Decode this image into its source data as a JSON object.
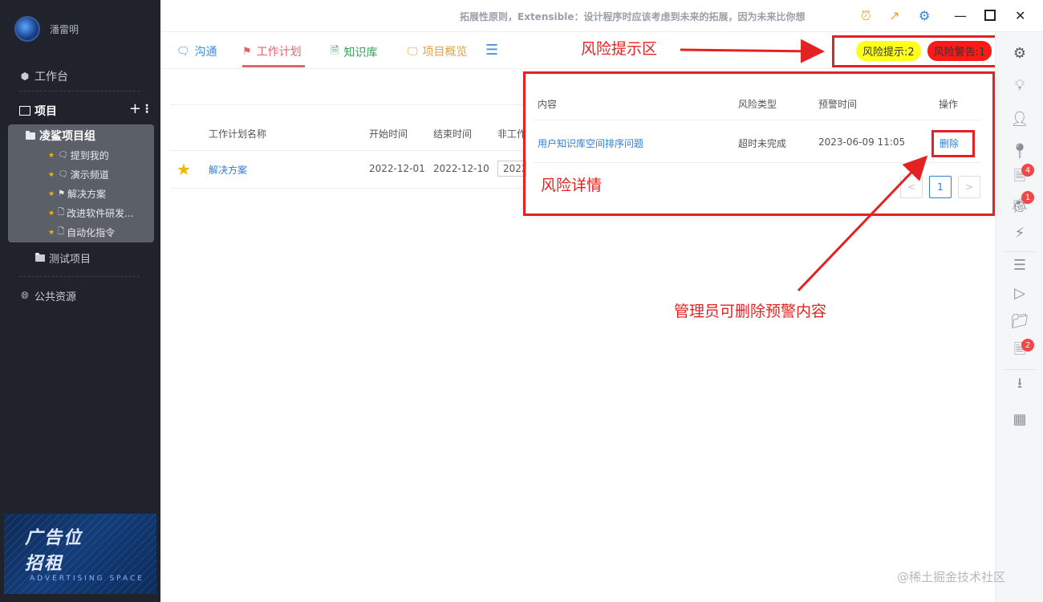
{
  "user": {
    "name": "潘雷明"
  },
  "sidebar": {
    "workbench": "工作台",
    "projects_label": "项目",
    "group": {
      "name": "凌鲨项目组",
      "items": [
        {
          "label": "提到我的",
          "icon": "chat-icon"
        },
        {
          "label": "演示频道",
          "icon": "chat-icon"
        },
        {
          "label": "解决方案",
          "icon": "flag-icon"
        },
        {
          "label": "改进软件研发...",
          "icon": "doc-icon"
        },
        {
          "label": "自动化指令",
          "icon": "doc-icon"
        }
      ]
    },
    "test_project": "测试项目",
    "public_resources": "公共资源",
    "ad": {
      "line1": "广告位",
      "line2": "招租",
      "sub": "ADVERTISING SPACE"
    }
  },
  "header": {
    "marquee": "拓展性原则，Extensible：设计程序时应该考虑到未来的拓展，因为未来比你想"
  },
  "tabs": [
    {
      "label": "沟通",
      "color": "#3a8ee6"
    },
    {
      "label": "工作计划",
      "color": "#e0656f"
    },
    {
      "label": "知识库",
      "color": "#3aa05a"
    },
    {
      "label": "项目概览",
      "color": "#e6a23c"
    }
  ],
  "risk": {
    "hint": "风险提示:2",
    "alarm": "风险警告:1"
  },
  "annotations": {
    "risk_area": "风险提示区",
    "risk_detail": "风险详情",
    "admin_delete": "管理员可删除预警内容"
  },
  "plan_table": {
    "headers": [
      "工作计划名称",
      "开始时间",
      "结束时间",
      "非工作"
    ],
    "row": {
      "name": "解决方案",
      "start": "2022-12-01",
      "end": "2022-12-10",
      "partial": "2022"
    }
  },
  "risk_popup": {
    "headers": [
      "内容",
      "风险类型",
      "预警时间",
      "操作"
    ],
    "row": {
      "content": "用户知识库空间排序问题",
      "type": "超时未完成",
      "time": "2023-06-09 11:05",
      "action": "删除"
    },
    "page": "1"
  },
  "right_badges": {
    "doc": "4",
    "bug": "1",
    "task": "2"
  },
  "watermark": "@稀土掘金技术社区",
  "colors": {
    "sidebar_bg": "#20232b",
    "accent_red": "#e52222",
    "link_blue": "#2f7fd4"
  }
}
